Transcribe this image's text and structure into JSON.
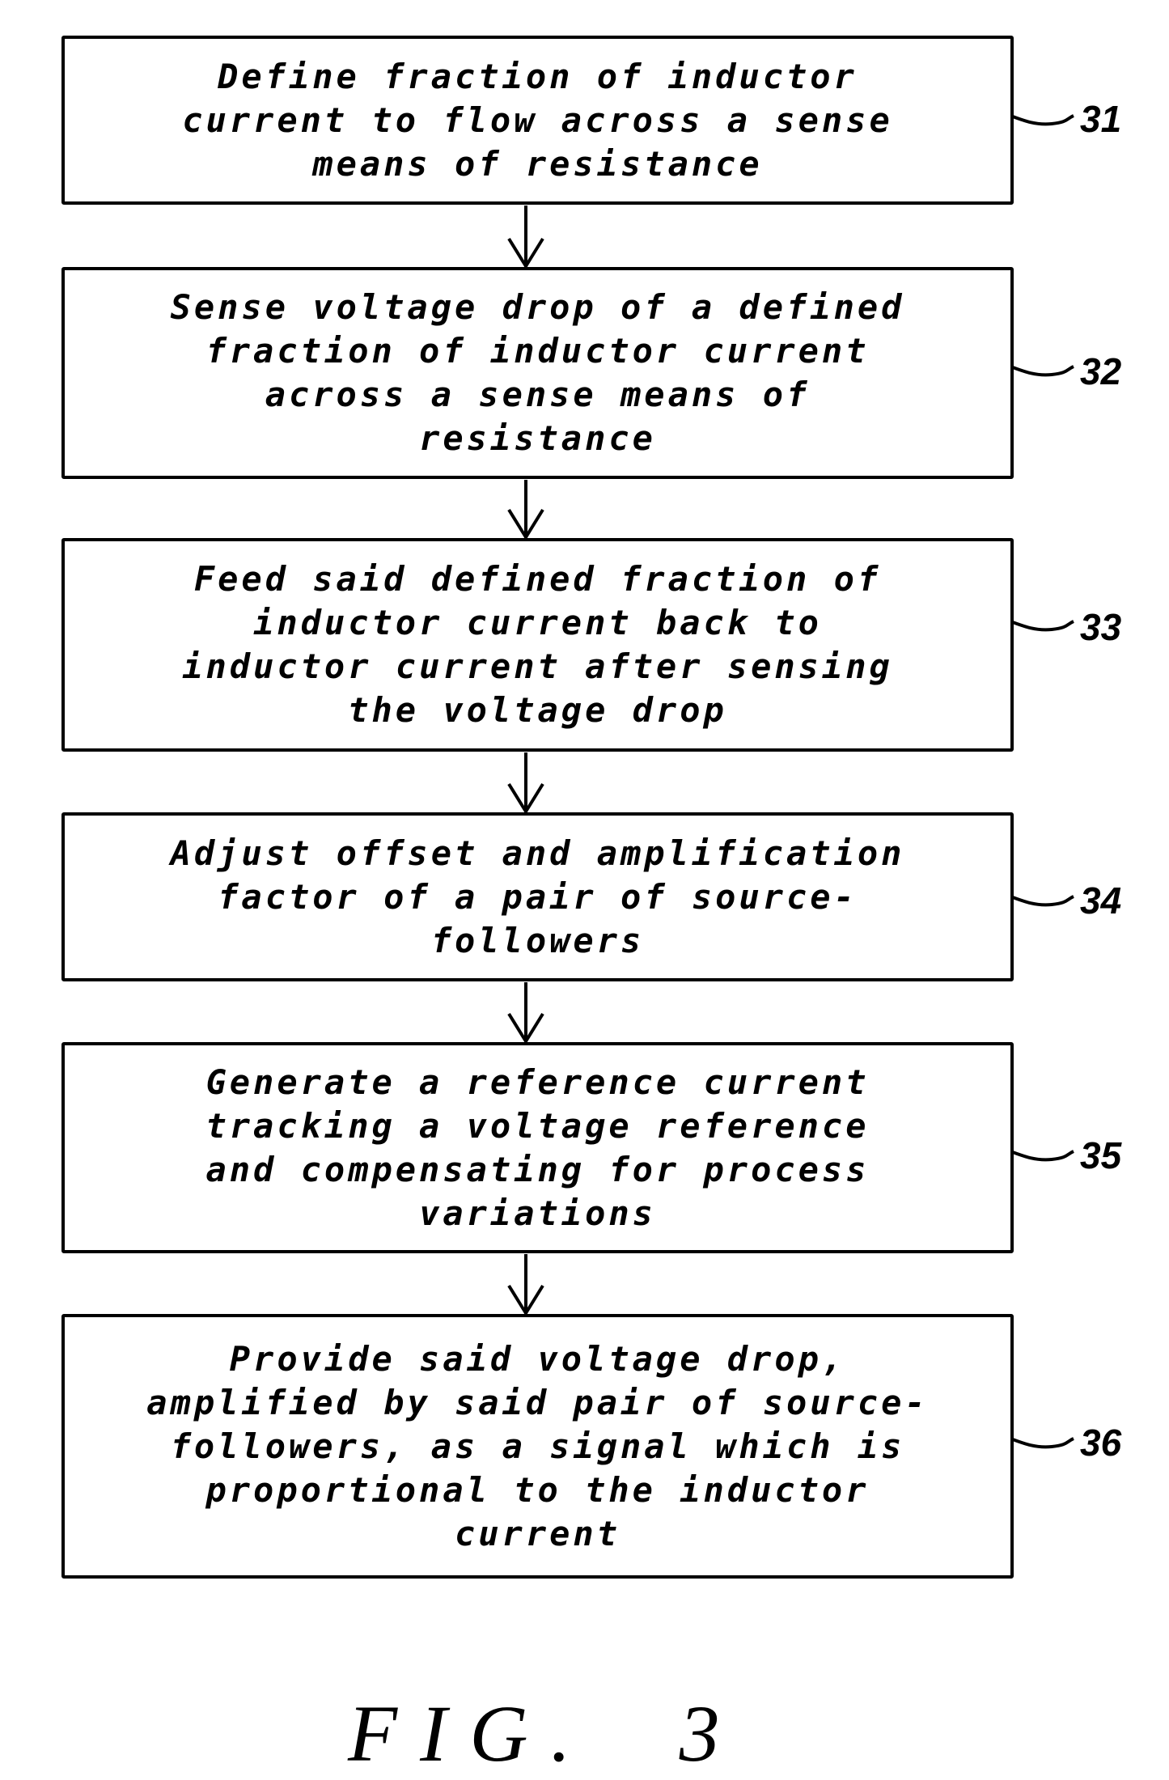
{
  "figure": {
    "caption": "FIG.  3",
    "steps": [
      {
        "ref": "31",
        "text": "Define fraction of inductor\ncurrent to flow across a sense\nmeans of resistance"
      },
      {
        "ref": "32",
        "text": "Sense voltage drop of a defined\nfraction of inductor current\nacross a sense means of\nresistance"
      },
      {
        "ref": "33",
        "text": "Feed said defined fraction of\ninductor current back to\ninductor current after sensing\nthe voltage drop"
      },
      {
        "ref": "34",
        "text": "Adjust offset and amplification\nfactor of a pair of source-\nfollowers"
      },
      {
        "ref": "35",
        "text": "Generate a reference current\ntracking a voltage reference\nand compensating for process\nvariations"
      },
      {
        "ref": "36",
        "text": "Provide said voltage drop,\namplified by said pair of source-\nfollowers, as a signal which is\nproportional to the inductor\ncurrent"
      }
    ],
    "flow": [
      [
        "31",
        "32"
      ],
      [
        "32",
        "33"
      ],
      [
        "33",
        "34"
      ],
      [
        "34",
        "35"
      ],
      [
        "35",
        "36"
      ]
    ],
    "colors": {
      "stroke": "#000000",
      "background": "#ffffff"
    }
  }
}
